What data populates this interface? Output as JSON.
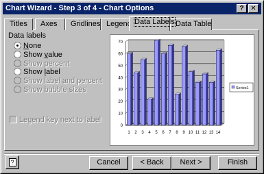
{
  "window": {
    "title": "Chart Wizard - Step 3 of 4 - Chart Options",
    "help_glyph": "?",
    "close_glyph": "✕"
  },
  "tabs": [
    {
      "label": "Titles"
    },
    {
      "label": "Axes"
    },
    {
      "label": "Gridlines"
    },
    {
      "label": "Legend"
    },
    {
      "label": "Data Labels",
      "active": true
    },
    {
      "label": "Data Table"
    }
  ],
  "data_labels": {
    "group_label": "Data labels",
    "options": [
      {
        "label": "None",
        "checked": true,
        "enabled": true
      },
      {
        "label": "Show value",
        "checked": false,
        "enabled": true
      },
      {
        "label": "Show percent",
        "checked": false,
        "enabled": false
      },
      {
        "label": "Show label",
        "checked": false,
        "enabled": true
      },
      {
        "label": "Show label and percent",
        "checked": false,
        "enabled": false
      },
      {
        "label": "Show bubble sizes",
        "checked": false,
        "enabled": false
      }
    ],
    "legend_key_label": "Legend key next to label",
    "legend_key_checked": false,
    "legend_key_enabled": false
  },
  "chart_data": {
    "type": "bar",
    "categories": [
      "1",
      "2",
      "3",
      "4",
      "5",
      "6",
      "7",
      "8",
      "9",
      "10",
      "11",
      "12",
      "13",
      "14"
    ],
    "series": [
      {
        "name": "Series1",
        "values": [
          60,
          44,
          55,
          22,
          71,
          60,
          67,
          26,
          66,
          45,
          36,
          43,
          36,
          63
        ]
      }
    ],
    "ylim": [
      0,
      70
    ],
    "yticks": [
      0,
      10,
      20,
      30,
      40,
      50,
      60,
      70
    ],
    "legend_position": "right",
    "bar_color": "#9999ff",
    "grid": true
  },
  "buttons": {
    "help_glyph": "?",
    "cancel": "Cancel",
    "back": "< Back",
    "next": "Next >",
    "finish": "Finish"
  }
}
